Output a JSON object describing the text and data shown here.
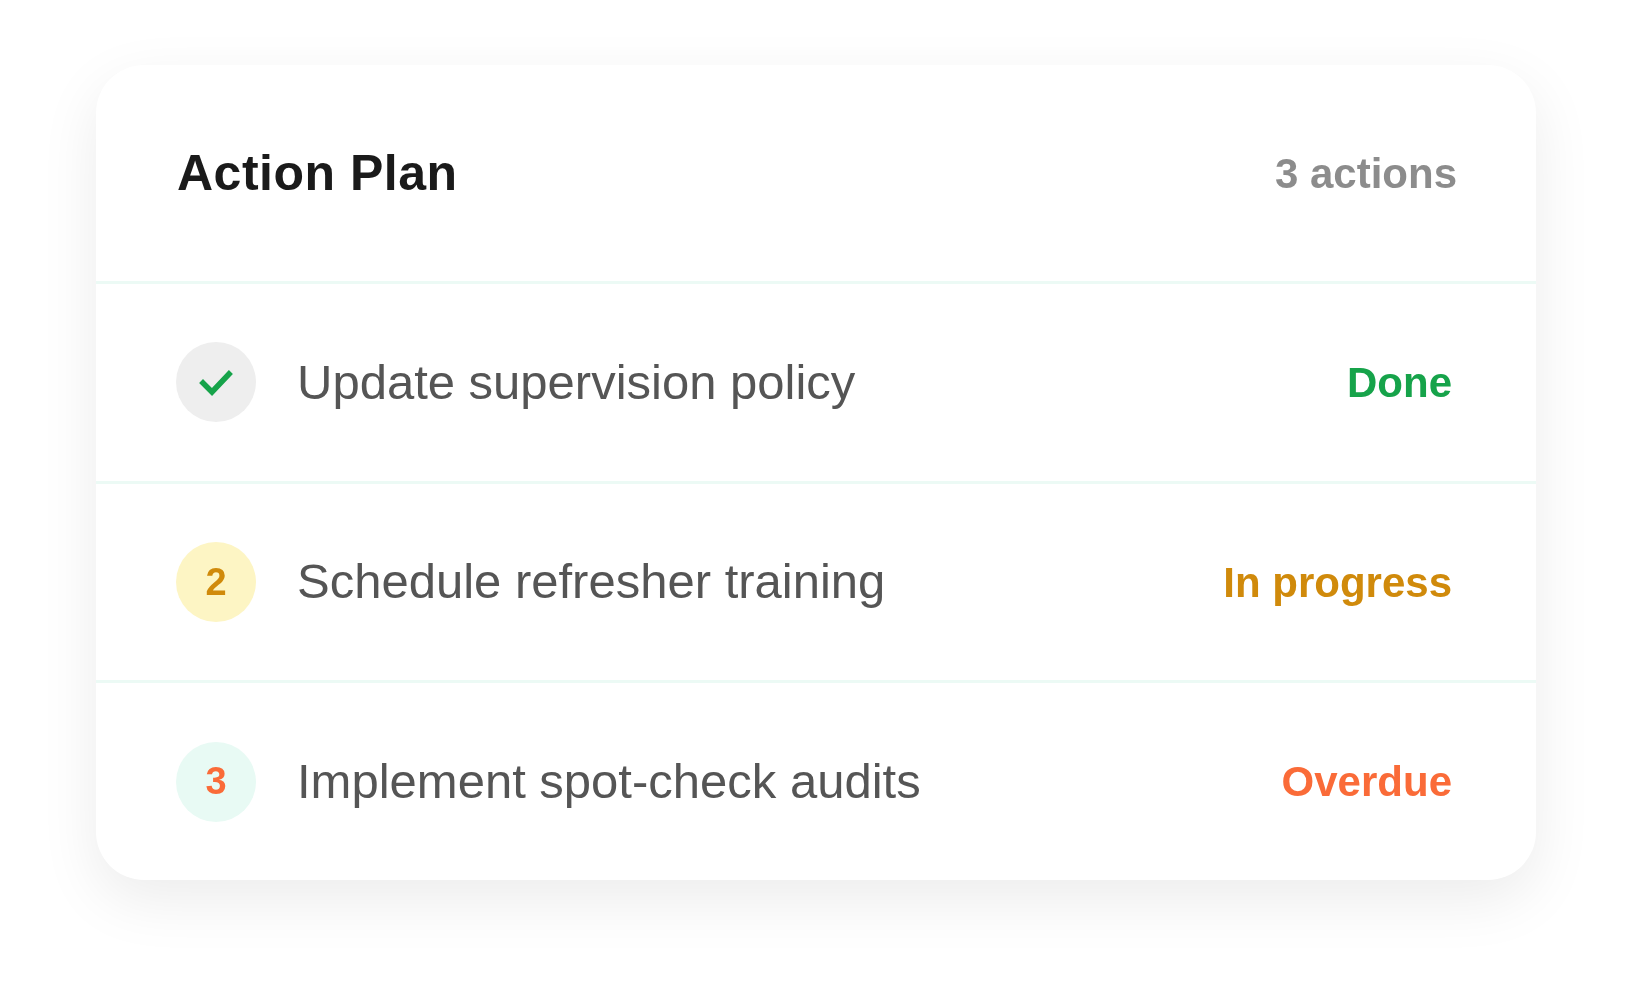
{
  "header": {
    "title": "Action Plan",
    "count": "3 actions"
  },
  "actions": [
    {
      "kind": "done",
      "label": "Update supervision policy",
      "status": {
        "label": "Done",
        "color": "#16a34a"
      }
    },
    {
      "kind": "in_progress",
      "number": "2",
      "label": "Schedule refresher training",
      "status": {
        "label": "In progress",
        "color": "#d08a0b"
      }
    },
    {
      "kind": "overdue",
      "number": "3",
      "label": "Implement spot-check audits",
      "status": {
        "label": "Overdue",
        "color": "#fa6b38"
      }
    }
  ]
}
